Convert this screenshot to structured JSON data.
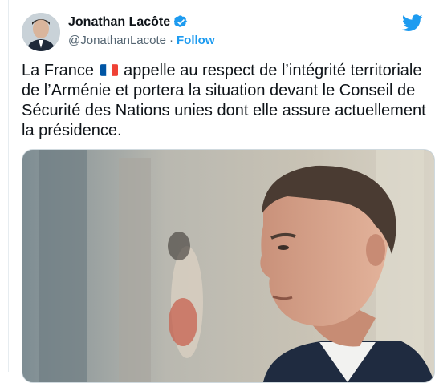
{
  "author": {
    "name": "Jonathan Lacôte",
    "handle": "@JonathanLacote",
    "separator": "·",
    "follow_label": "Follow"
  },
  "tweet": {
    "text_before_flag": "La France",
    "flag_icon": "france-flag-emoji",
    "text_after_flag": " appelle au respect de l’intégrité territoriale de l’Arménie et portera la situation devant le Conseil de Sécurité des Nations unies dont elle assure actuellement la présidence."
  },
  "colors": {
    "accent": "#1d9bf0",
    "text": "#0f1419",
    "muted": "#536471"
  },
  "icons": [
    "verified-badge-icon",
    "twitter-bird-icon"
  ]
}
